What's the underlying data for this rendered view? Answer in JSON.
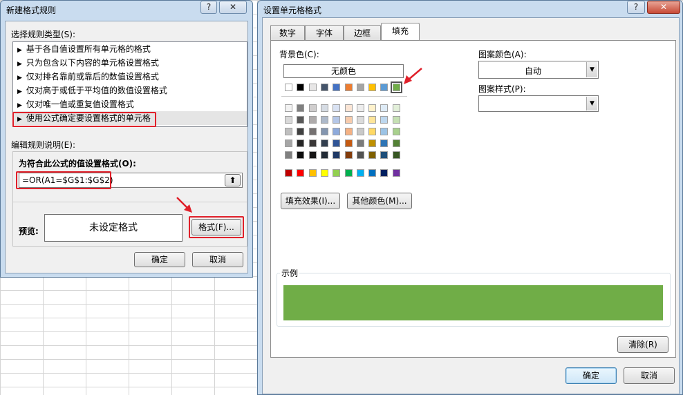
{
  "left_dialog": {
    "title": "新建格式规则",
    "help_glyph": "?",
    "close_glyph": "✕",
    "rule_type_label": "选择规则类型(S):",
    "rule_types": [
      {
        "label": "基于各自值设置所有单元格的格式"
      },
      {
        "label": "只为包含以下内容的单元格设置格式"
      },
      {
        "label": "仅对排名靠前或靠后的数值设置格式"
      },
      {
        "label": "仅对高于或低于平均值的数值设置格式"
      },
      {
        "label": "仅对唯一值或重复值设置格式"
      },
      {
        "label": "使用公式确定要设置格式的单元格"
      }
    ],
    "triangle_glyph": "▶",
    "edit_desc_label": "编辑规则说明(E):",
    "formula_label": "为符合此公式的值设置格式(O):",
    "formula_value": "=OR(A1=$G$1:$G$2)",
    "collapse_glyph": "⬆",
    "preview_label": "预览:",
    "preview_text": "未设定格式",
    "format_button": "格式(F)...",
    "ok_button": "确定",
    "cancel_button": "取消"
  },
  "right_dialog": {
    "title": "设置单元格格式",
    "help_glyph": "?",
    "close_glyph": "✕",
    "tabs": [
      {
        "label": "数字"
      },
      {
        "label": "字体"
      },
      {
        "label": "边框"
      },
      {
        "label": "填充"
      }
    ],
    "bg_color_label": "背景色(C):",
    "no_color_button": "无颜色",
    "fill_effects_button": "填充效果(I)...",
    "more_colors_button": "其他颜色(M)...",
    "pattern_color_label": "图案颜色(A):",
    "pattern_color_value": "自动",
    "pattern_style_label": "图案样式(P):",
    "pattern_style_value": "",
    "dropdown_glyph": "▼",
    "sample_label": "示例",
    "clear_button": "清除(R)",
    "ok_button": "确定",
    "cancel_button": "取消",
    "sample_color": "#70ad47",
    "theme_row": [
      "#ffffff",
      "#000000",
      "#e7e6e6",
      "#44546a",
      "#4472c4",
      "#ed7d31",
      "#a5a5a5",
      "#ffc000",
      "#5b9bd5",
      "#70ad47"
    ],
    "tint_rows": [
      [
        "#f2f2f2",
        "#808080",
        "#d0cece",
        "#d6dce4",
        "#d9e2f3",
        "#fbe5d5",
        "#ededed",
        "#fff2cc",
        "#deebf6",
        "#e2efd9"
      ],
      [
        "#d9d9d9",
        "#595959",
        "#aeabab",
        "#adb9ca",
        "#b4c6e7",
        "#f7cbac",
        "#dbdbdb",
        "#fee599",
        "#bdd7ee",
        "#c5e0b3"
      ],
      [
        "#bfbfbf",
        "#404040",
        "#757171",
        "#8496b0",
        "#8eaadb",
        "#f4b183",
        "#c9c9c9",
        "#ffd965",
        "#9cc3e5",
        "#a8d08d"
      ],
      [
        "#a6a6a6",
        "#262626",
        "#3a3838",
        "#323f4f",
        "#2f5496",
        "#c55a11",
        "#7b7b7b",
        "#bf9000",
        "#2e75b5",
        "#538135"
      ],
      [
        "#808080",
        "#0d0d0d",
        "#171616",
        "#222a35",
        "#1f3864",
        "#833c0b",
        "#525252",
        "#7f6000",
        "#1e4e79",
        "#375623"
      ]
    ],
    "standard_row": [
      "#c00000",
      "#ff0000",
      "#ffc000",
      "#ffff00",
      "#92d050",
      "#00b050",
      "#00b0f0",
      "#0070c0",
      "#002060",
      "#7030a0"
    ],
    "selected_index": 9
  },
  "colors": {
    "accent_red": "#e0202a"
  }
}
